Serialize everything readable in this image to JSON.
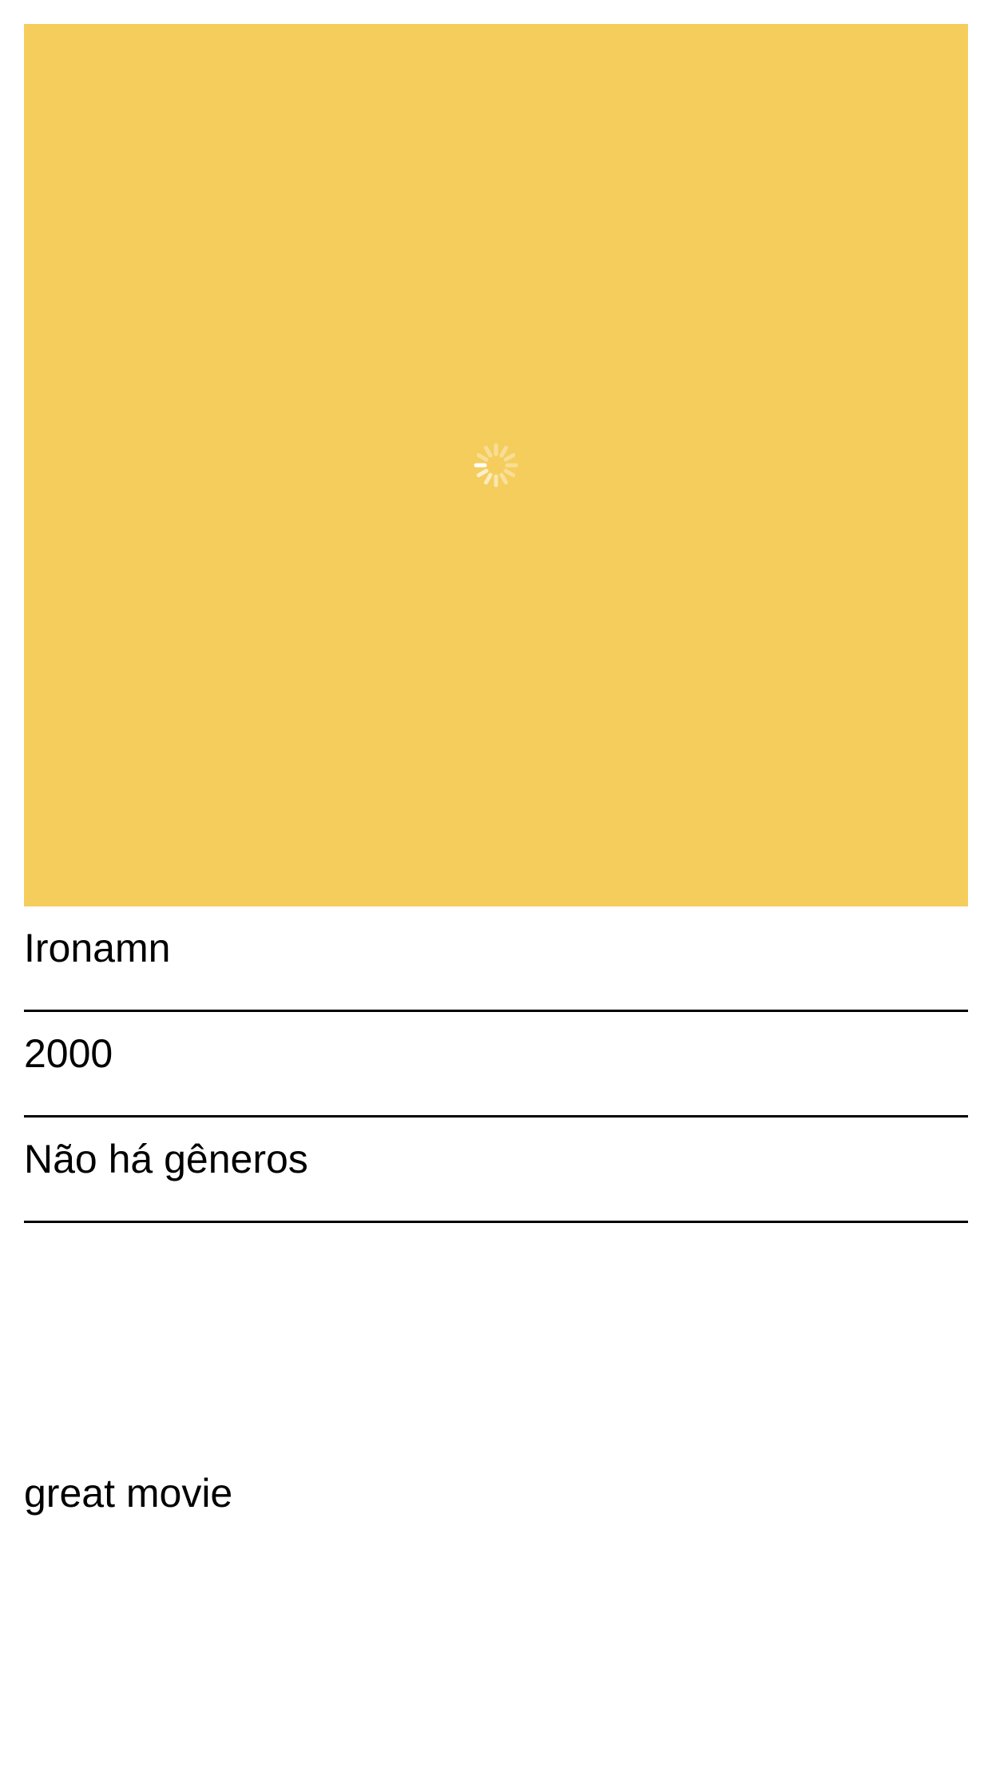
{
  "movie": {
    "poster_color": "#f5cd5d",
    "poster_state": "loading",
    "loading_icon": "activity-spinner-icon",
    "title": "Ironamn",
    "year": "2000",
    "genres": "Não há gêneros",
    "review": "great movie"
  }
}
